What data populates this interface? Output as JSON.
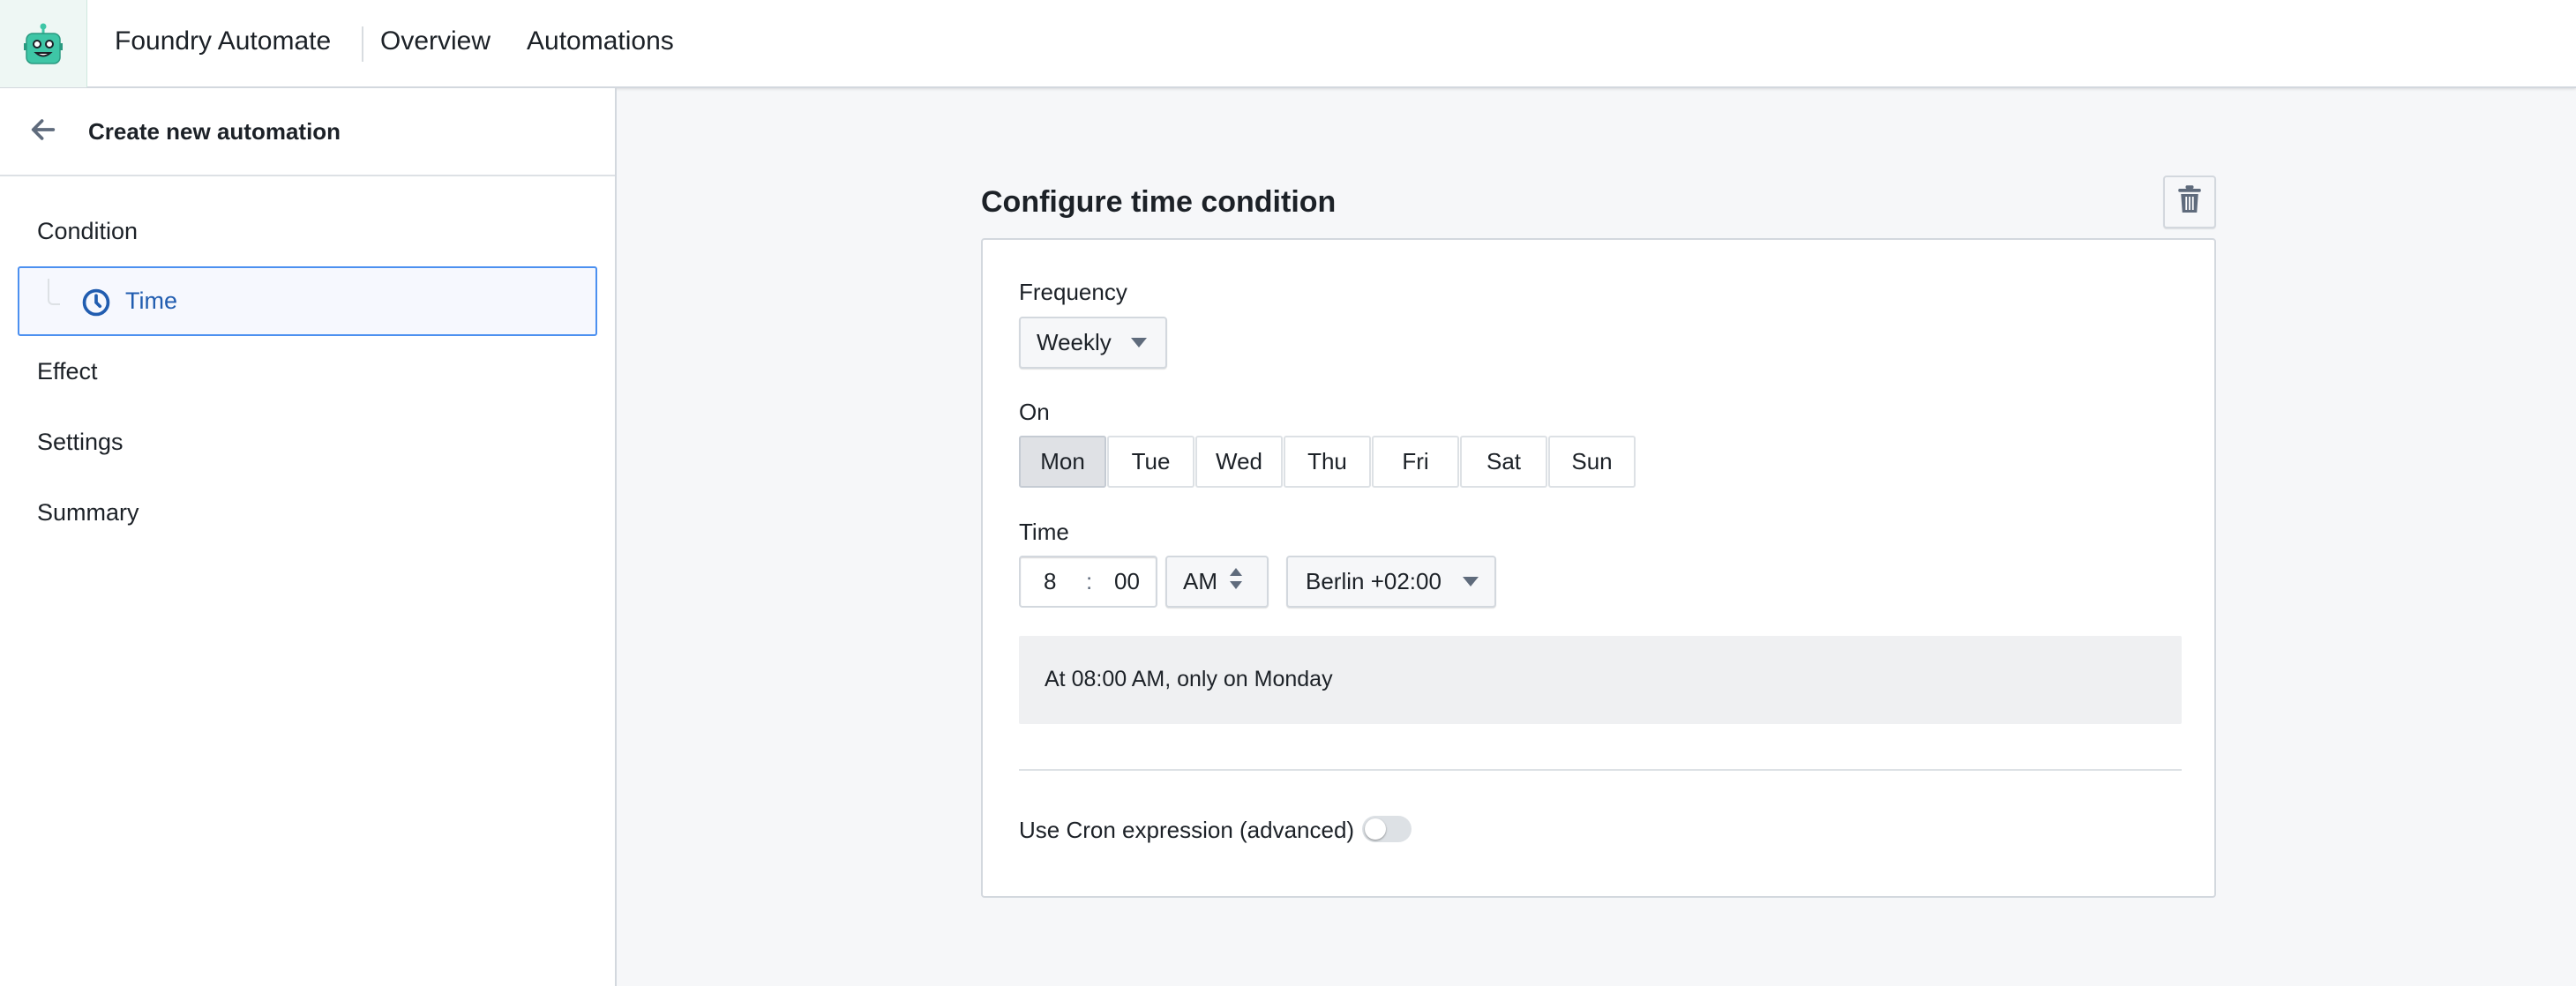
{
  "header": {
    "app_title": "Foundry Automate",
    "nav": [
      {
        "label": "Overview"
      },
      {
        "label": "Automations"
      }
    ],
    "logo_color": "#3ec6a6"
  },
  "sidebar": {
    "back_title": "Create new automation",
    "items": [
      {
        "label": "Condition"
      },
      {
        "label": "Time",
        "selected": true,
        "icon": "clock-icon"
      },
      {
        "label": "Effect"
      },
      {
        "label": "Settings"
      },
      {
        "label": "Summary"
      }
    ]
  },
  "main": {
    "title": "Configure time condition",
    "frequency": {
      "label": "Frequency",
      "value": "Weekly"
    },
    "on": {
      "label": "On",
      "days": [
        "Mon",
        "Tue",
        "Wed",
        "Thu",
        "Fri",
        "Sat",
        "Sun"
      ],
      "selected": "Mon"
    },
    "time": {
      "label": "Time",
      "hour": "8",
      "separator": ":",
      "minute": "00",
      "ampm": "AM",
      "timezone": "Berlin +02:00"
    },
    "summary": "At 08:00 AM, only on Monday",
    "cron": {
      "label": "Use Cron expression (advanced)",
      "enabled": false
    }
  },
  "colors": {
    "accent": "#215db0",
    "selection_border": "#4c90f0"
  }
}
